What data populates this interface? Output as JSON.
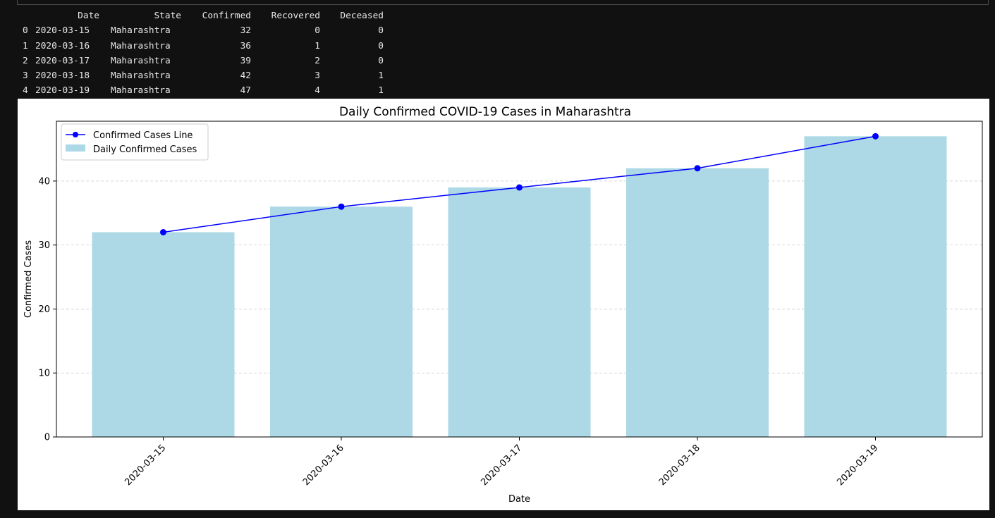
{
  "dataframe": {
    "columns": [
      "Date",
      "State",
      "Confirmed",
      "Recovered",
      "Deceased"
    ],
    "rows": [
      {
        "index": "0",
        "Date": "2020-03-15",
        "State": "Maharashtra",
        "Confirmed": "32",
        "Recovered": "0",
        "Deceased": "0"
      },
      {
        "index": "1",
        "Date": "2020-03-16",
        "State": "Maharashtra",
        "Confirmed": "36",
        "Recovered": "1",
        "Deceased": "0"
      },
      {
        "index": "2",
        "Date": "2020-03-17",
        "State": "Maharashtra",
        "Confirmed": "39",
        "Recovered": "2",
        "Deceased": "0"
      },
      {
        "index": "3",
        "Date": "2020-03-18",
        "State": "Maharashtra",
        "Confirmed": "42",
        "Recovered": "3",
        "Deceased": "1"
      },
      {
        "index": "4",
        "Date": "2020-03-19",
        "State": "Maharashtra",
        "Confirmed": "47",
        "Recovered": "4",
        "Deceased": "1"
      }
    ]
  },
  "chart_data": {
    "type": "bar",
    "title": "Daily Confirmed COVID-19 Cases in Maharashtra",
    "xlabel": "Date",
    "ylabel": "Confirmed Cases",
    "categories": [
      "2020-03-15",
      "2020-03-16",
      "2020-03-17",
      "2020-03-18",
      "2020-03-19"
    ],
    "series": [
      {
        "name": "Confirmed Cases Line",
        "type": "line",
        "color": "#0000ff",
        "marker": "circle",
        "values": [
          32,
          36,
          39,
          42,
          47
        ]
      },
      {
        "name": "Daily Confirmed Cases",
        "type": "bar",
        "color": "#add8e6",
        "values": [
          32,
          36,
          39,
          42,
          47
        ]
      }
    ],
    "ylim": [
      0,
      49.35
    ],
    "yticks": [
      0,
      10,
      20,
      30,
      40
    ],
    "grid": "y, dashed",
    "legend": "top-left"
  }
}
